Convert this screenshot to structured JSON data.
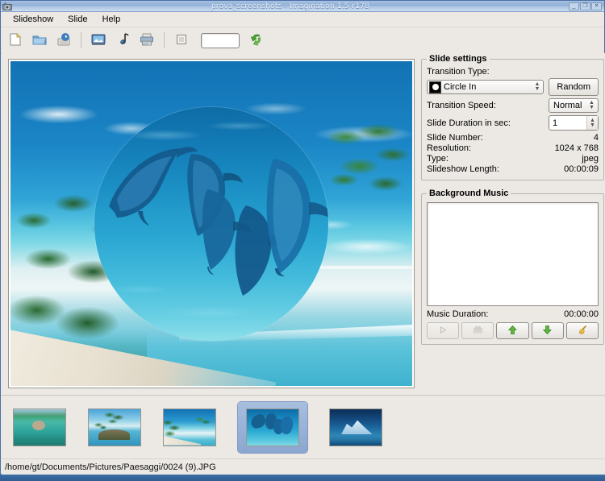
{
  "window": {
    "title": "prova_screenshots - Imagination 1.5-r178",
    "app_icon": "imagination-camera-icon",
    "controls": {
      "minimize": "_",
      "maximize": "❐",
      "close": "✕"
    }
  },
  "menubar": {
    "items": [
      {
        "label": "Slideshow",
        "accel": "S",
        "name": "menu-slideshow"
      },
      {
        "label": "Slide",
        "accel": "S",
        "name": "menu-slide"
      },
      {
        "label": "Help",
        "accel": "H",
        "name": "menu-help"
      }
    ]
  },
  "toolbar": {
    "buttons": [
      {
        "name": "new-slideshow-button",
        "icon": "new-document-icon",
        "tooltip": "New slideshow"
      },
      {
        "name": "open-slideshow-button",
        "icon": "open-folder-icon",
        "tooltip": "Open slideshow"
      },
      {
        "name": "save-slideshow-button",
        "icon": "save-disk-icon",
        "tooltip": "Save slideshow"
      },
      {
        "name": "import-slides-button",
        "icon": "import-picture-icon",
        "tooltip": "Import slides"
      },
      {
        "name": "import-music-button",
        "icon": "import-music-icon",
        "tooltip": "Import music"
      },
      {
        "name": "export-button",
        "icon": "export-printer-icon",
        "tooltip": "Export slideshow"
      },
      {
        "name": "stop-button",
        "icon": "stop-square-icon",
        "tooltip": "Stop"
      },
      {
        "name": "zoom-entry",
        "icon": "text-entry",
        "value": "",
        "placeholder": ""
      },
      {
        "name": "preview-button",
        "icon": "green-refresh-arrow-icon",
        "tooltip": "Start preview"
      }
    ]
  },
  "slide_settings": {
    "group_title": "Slide settings",
    "transition_type_label": "Transition Type:",
    "transition_type_value": "Circle In",
    "transition_type_icon": "circle-in-icon",
    "random_button": "Random",
    "transition_speed_label": "Transition Speed:",
    "transition_speed_value": "Normal",
    "slide_duration_label": "Slide Duration in sec:",
    "slide_duration_value": "1",
    "info": [
      {
        "label": "Slide Number:",
        "value": "4"
      },
      {
        "label": "Resolution:",
        "value": "1024 x 768"
      },
      {
        "label": "Type:",
        "value": "jpeg"
      },
      {
        "label": "Slideshow Length:",
        "value": "00:00:09"
      }
    ]
  },
  "background_music": {
    "group_title": "Background Music",
    "list_items": [],
    "duration_label": "Music Duration:",
    "duration_value": "00:00:00",
    "buttons": [
      {
        "name": "play-music-button",
        "icon": "play-triangle-icon",
        "enabled": false
      },
      {
        "name": "stop-music-button",
        "icon": "stop-media-icon",
        "enabled": false
      },
      {
        "name": "move-up-button",
        "icon": "green-up-arrow-icon",
        "enabled": true
      },
      {
        "name": "move-down-button",
        "icon": "green-down-arrow-icon",
        "enabled": true
      },
      {
        "name": "clear-music-button",
        "icon": "yellow-broom-icon",
        "enabled": true
      }
    ]
  },
  "preview": {
    "name": "slide-preview",
    "transition_shape": "circle",
    "background_image": "tropical-beach-with-palms",
    "foreground_image": "dolphins-underwater"
  },
  "thumbnails": {
    "items": [
      {
        "name": "thumbnail-slide-1",
        "alt": "lagoon-with-rock",
        "selected": false
      },
      {
        "name": "thumbnail-slide-2",
        "alt": "palm-island",
        "selected": false
      },
      {
        "name": "thumbnail-slide-3",
        "alt": "beach-with-palm",
        "selected": false
      },
      {
        "name": "thumbnail-slide-4",
        "alt": "dolphins-underwater",
        "selected": true
      },
      {
        "name": "thumbnail-slide-5",
        "alt": "iceberg",
        "selected": false
      }
    ]
  },
  "statusbar": {
    "path": "/home/gt/Documents/Pictures/Paesaggi/0024 (9).JPG"
  },
  "colors": {
    "titlebar_blue": "#8fb0d8",
    "panel_grey": "#ece9e4",
    "selection_blue": "#8ba6cf",
    "accent_green": "#3b9a2f",
    "taskbar_blue": "#3b6ea5"
  }
}
